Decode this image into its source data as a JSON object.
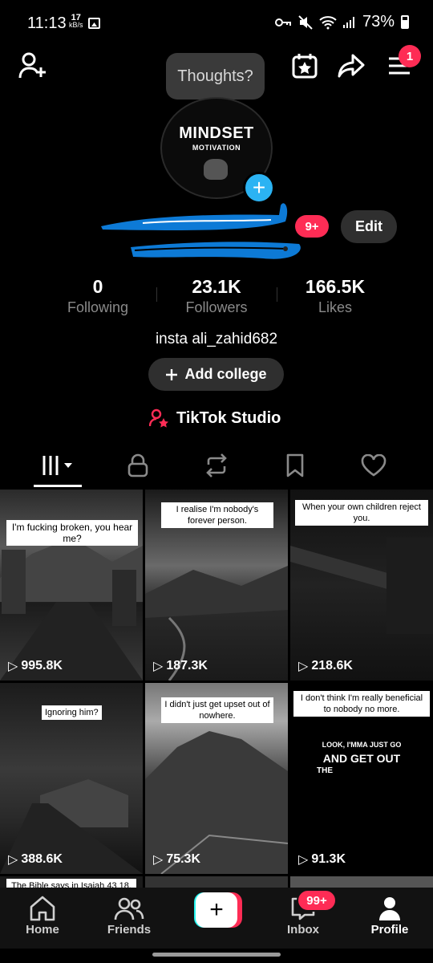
{
  "status_bar": {
    "time": "11:13",
    "speed_value": "17",
    "speed_unit": "kB/s",
    "battery": "73%"
  },
  "header": {
    "notification_count": "1",
    "thoughts_placeholder": "Thoughts?"
  },
  "avatar": {
    "line1": "MINDSET",
    "line2": "MOTIVATION"
  },
  "profile": {
    "unread_badge": "9+",
    "edit_label": "Edit",
    "bio": "insta ali_zahid682",
    "add_college_label": "Add college",
    "studio_label": "TikTok Studio"
  },
  "stats": [
    {
      "value": "0",
      "label": "Following"
    },
    {
      "value": "23.1K",
      "label": "Followers"
    },
    {
      "value": "166.5K",
      "label": "Likes"
    }
  ],
  "tabs": [
    "videos",
    "private",
    "reposts",
    "favorites",
    "liked"
  ],
  "videos": [
    {
      "caption": "I'm fucking broken, you hear me?",
      "views": "995.8K"
    },
    {
      "caption": "I realise I'm nobody's forever person.",
      "views": "187.3K"
    },
    {
      "caption": "When your own children reject you.",
      "views": "218.6K"
    },
    {
      "caption": "Ignoring him?",
      "views": "388.6K"
    },
    {
      "caption": "I didn't just get upset out of nowhere.",
      "views": "75.3K"
    },
    {
      "caption": "I don't think I'm really beneficial to nobody no more.",
      "views": "91.3K",
      "quote1": "LOOK, I'MMA JUST GO",
      "quote2": "AND GET OUT",
      "quote3": "THE"
    },
    {
      "caption": "The Bible says in Isaiah 43 18."
    }
  ],
  "bottom_nav": {
    "home": "Home",
    "friends": "Friends",
    "inbox": "Inbox",
    "profile": "Profile",
    "inbox_badge": "99+"
  },
  "colors": {
    "accent": "#fe2c55",
    "cyan": "#25f4ee",
    "blue_plus": "#2bb3f3"
  }
}
